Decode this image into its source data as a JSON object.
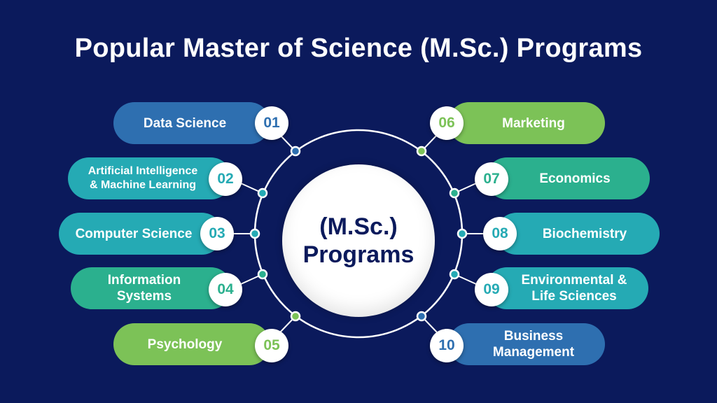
{
  "title": "Popular Master of Science (M.Sc.) Programs",
  "center": {
    "line1": "(M.Sc.)",
    "line2": "Programs"
  },
  "colors": {
    "background": "#0b1a5c",
    "blue": "#2e6fb0",
    "teal": "#25aab4",
    "green": "#2bb08e",
    "lightgreen": "#7cc257"
  },
  "programs": [
    {
      "number": "01",
      "label": "Data Science",
      "color": "blue"
    },
    {
      "number": "02",
      "label": "Artificial Intelligence & Machine Learning",
      "label_line1": "Artificial Intelligence",
      "label_line2": "& Machine Learning",
      "color": "teal"
    },
    {
      "number": "03",
      "label": "Computer Science",
      "color": "teal"
    },
    {
      "number": "04",
      "label": "Information Systems",
      "label_line1": "Information",
      "label_line2": "Systems",
      "color": "green"
    },
    {
      "number": "05",
      "label": "Psychology",
      "color": "lightgreen"
    },
    {
      "number": "06",
      "label": "Marketing",
      "color": "lightgreen"
    },
    {
      "number": "07",
      "label": "Economics",
      "color": "green"
    },
    {
      "number": "08",
      "label": "Biochemistry",
      "color": "teal"
    },
    {
      "number": "09",
      "label": "Environmental & Life Sciences",
      "label_line1": "Environmental &",
      "label_line2": "Life Sciences",
      "color": "teal"
    },
    {
      "number": "10",
      "label": "Business Management",
      "label_line1": "Business",
      "label_line2": "Management",
      "color": "blue"
    }
  ]
}
